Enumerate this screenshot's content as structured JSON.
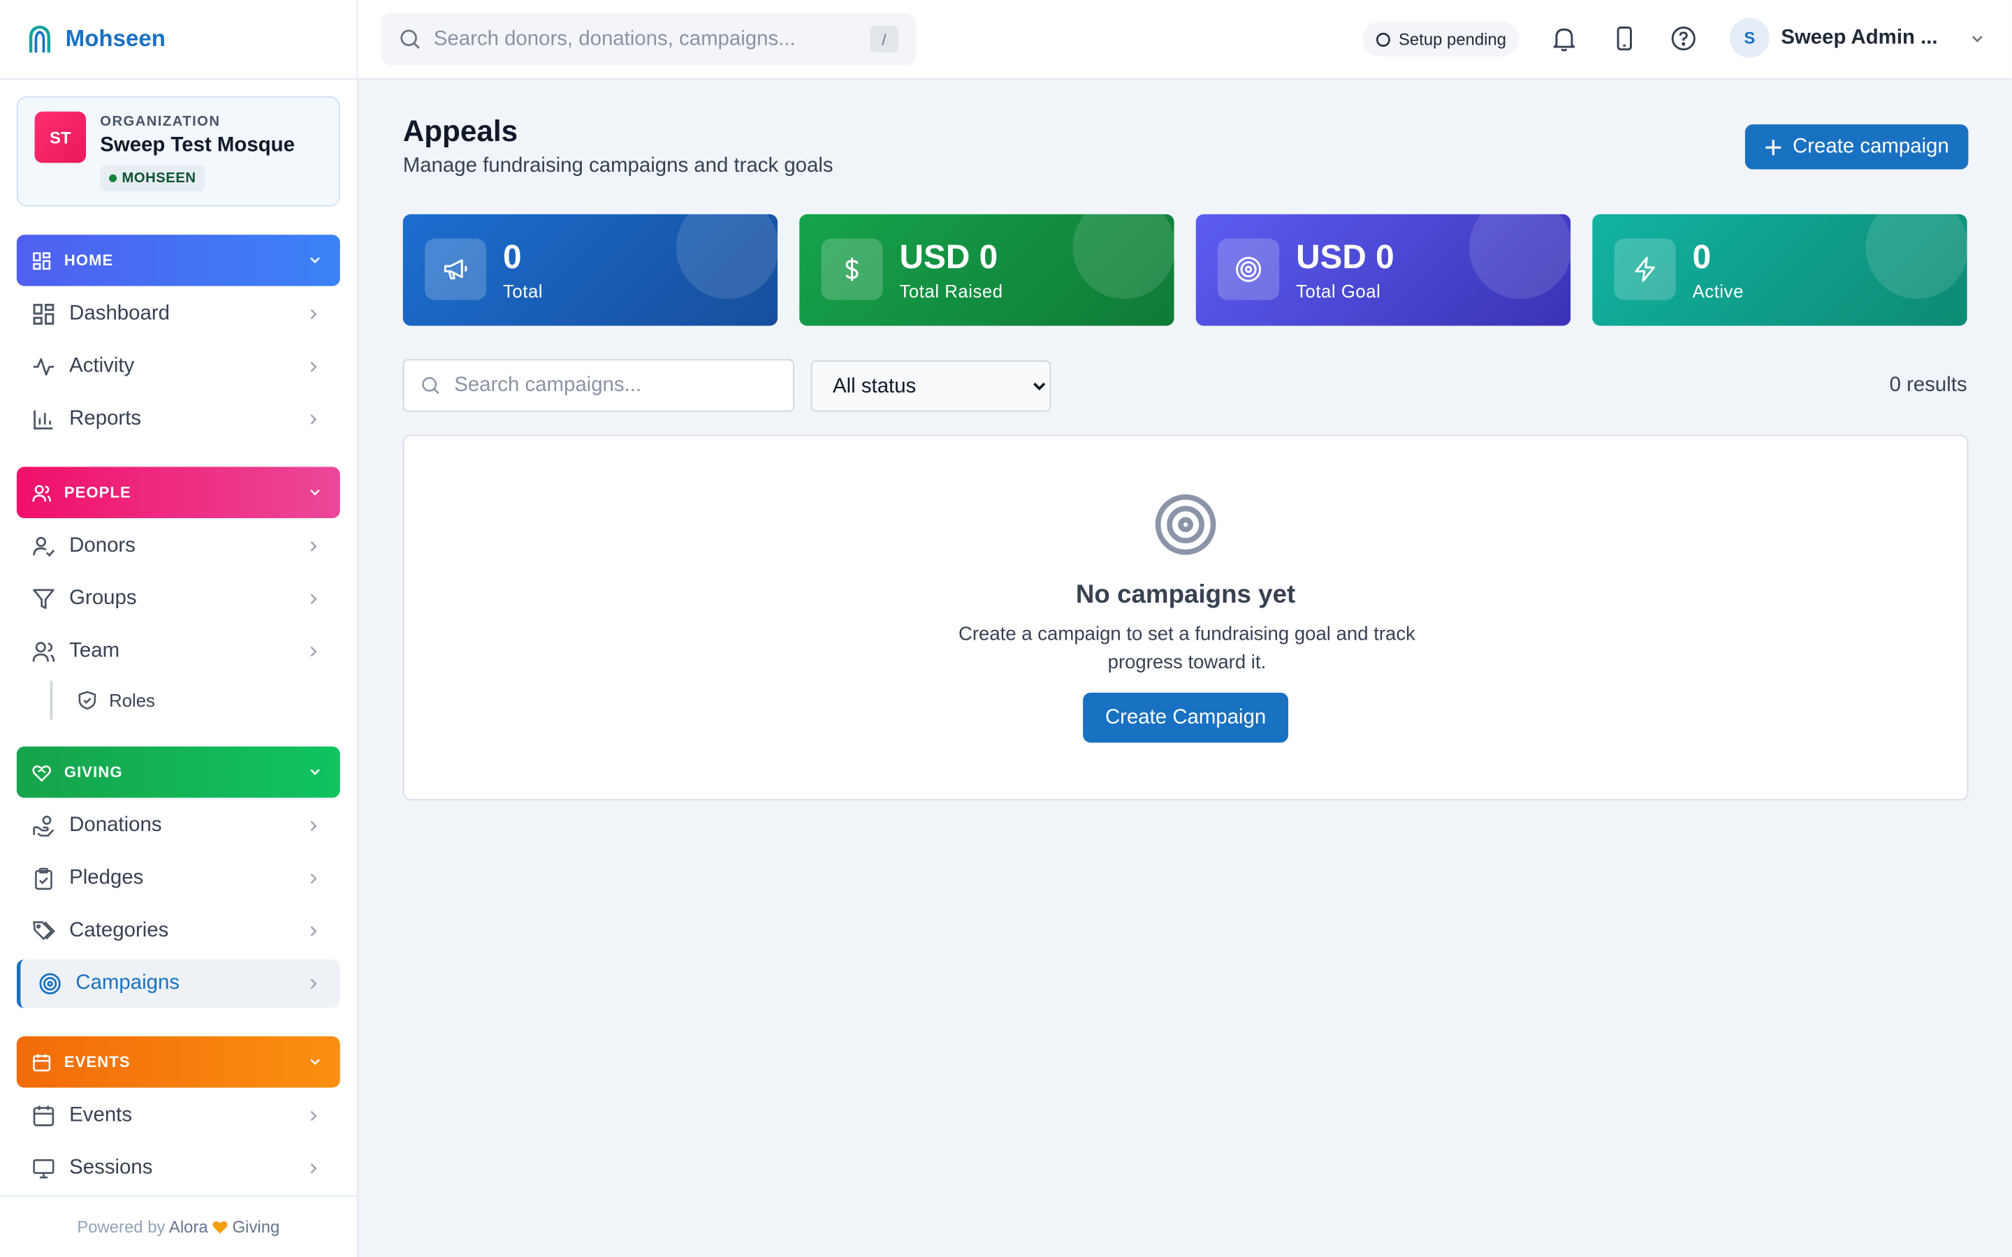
{
  "brand": {
    "name": "Mohseen"
  },
  "org": {
    "initials": "ST",
    "kicker": "ORGANIZATION",
    "name": "Sweep Test Mosque",
    "badge": "MOHSEEN"
  },
  "sidebar": {
    "home": {
      "label": "HOME",
      "items": [
        {
          "label": "Dashboard"
        },
        {
          "label": "Activity"
        },
        {
          "label": "Reports"
        }
      ]
    },
    "people": {
      "label": "PEOPLE",
      "items": [
        {
          "label": "Donors"
        },
        {
          "label": "Groups"
        },
        {
          "label": "Team"
        }
      ],
      "sub": [
        {
          "label": "Roles"
        }
      ]
    },
    "giving": {
      "label": "GIVING",
      "items": [
        {
          "label": "Donations"
        },
        {
          "label": "Pledges"
        },
        {
          "label": "Categories"
        },
        {
          "label": "Campaigns"
        }
      ]
    },
    "events": {
      "label": "EVENTS",
      "items": [
        {
          "label": "Events"
        },
        {
          "label": "Sessions"
        }
      ]
    }
  },
  "footer": {
    "prefix": "Powered by",
    "brand1": "Alora",
    "brand2": "Giving"
  },
  "topbar": {
    "search_placeholder": "Search donors, donations, campaigns...",
    "shortcut": "/",
    "setup": "Setup pending",
    "user_initial": "S",
    "user_name": "Sweep Admin ..."
  },
  "page": {
    "title": "Appeals",
    "subtitle": "Manage fundraising campaigns and track goals",
    "create_label": "Create campaign"
  },
  "stats": [
    {
      "value": "0",
      "label": "Total",
      "icon": "megaphone-icon"
    },
    {
      "value": "USD 0",
      "label": "Total Raised",
      "icon": "dollar-icon"
    },
    {
      "value": "USD 0",
      "label": "Total Goal",
      "icon": "target-icon"
    },
    {
      "value": "0",
      "label": "Active",
      "icon": "bolt-icon"
    }
  ],
  "filters": {
    "search_placeholder": "Search campaigns...",
    "status_selected": "All status",
    "results": "0 results"
  },
  "empty": {
    "title": "No campaigns yet",
    "description": "Create a campaign to set a fundraising goal and track progress toward it.",
    "button": "Create Campaign"
  },
  "colors": {
    "accent": "#1971c2",
    "home": "#4f60f0",
    "people": "#f0106a",
    "giving": "#16a34a",
    "events": "#f26b0a"
  }
}
